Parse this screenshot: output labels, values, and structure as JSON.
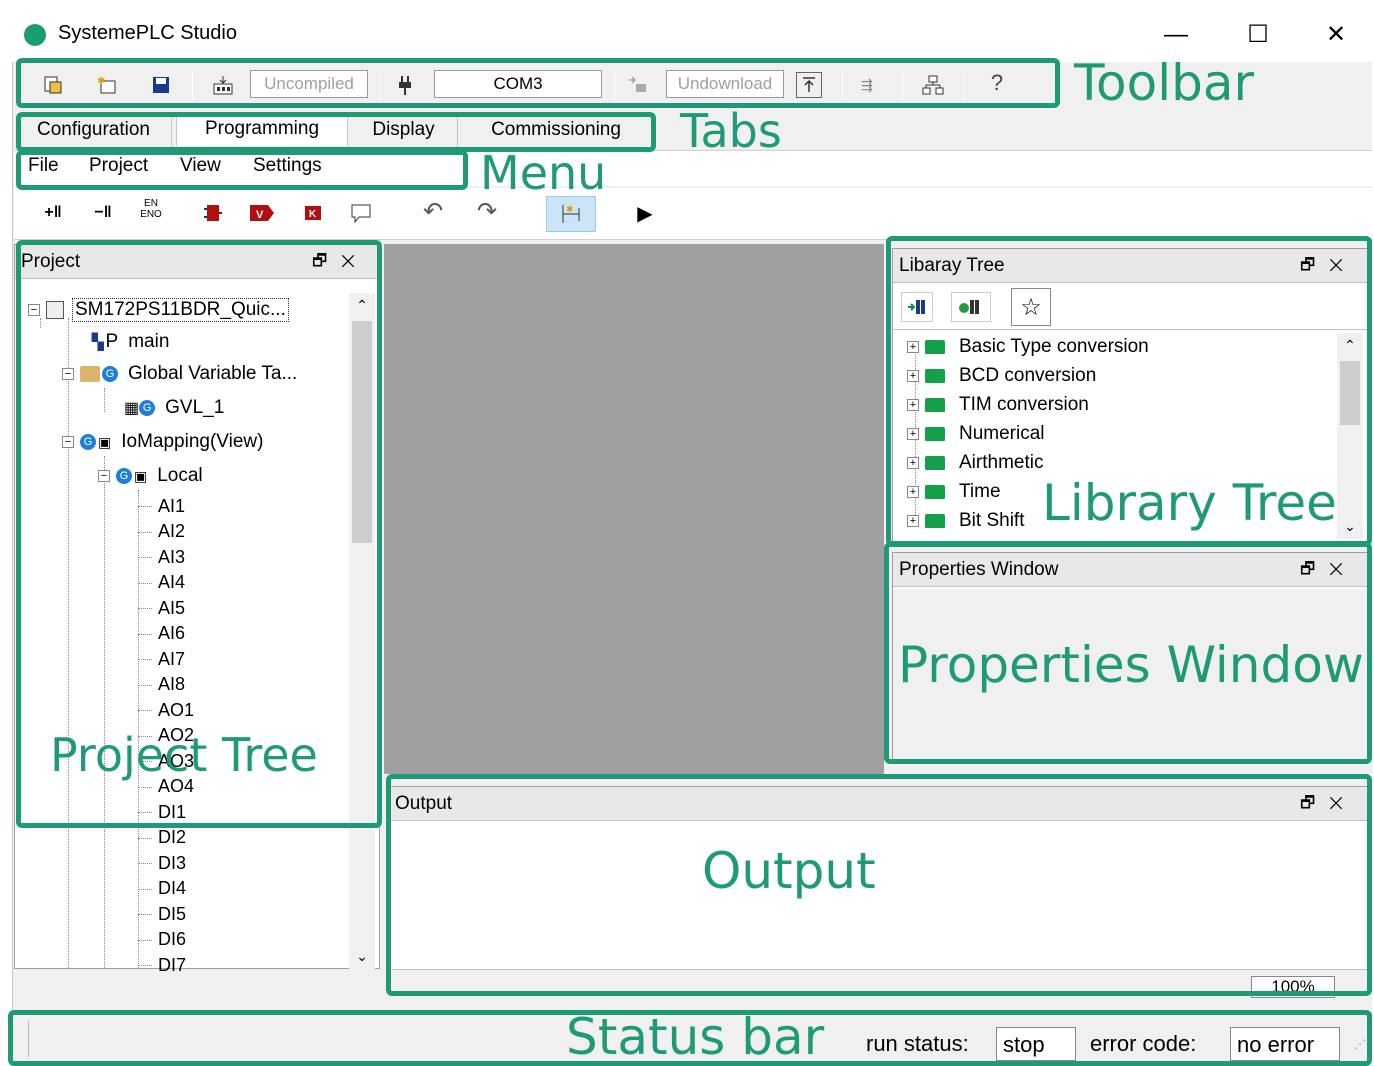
{
  "app": {
    "title": "SystemePLC Studio",
    "window_controls": {
      "minimize": "—",
      "maximize": "☐",
      "close": "✕"
    }
  },
  "toolbar": {
    "compile_status": "Uncompiled",
    "port": "COM3",
    "download_status": "Undownload"
  },
  "tabs": [
    {
      "label": "Configuration"
    },
    {
      "label": "Programming",
      "active": true
    },
    {
      "label": "Display"
    },
    {
      "label": "Commissioning"
    }
  ],
  "menu": [
    "File",
    "Project",
    "View",
    "Settings"
  ],
  "project_panel": {
    "title": "Project",
    "float_icon": "🗗",
    "close_icon": "✕",
    "tree": {
      "root": "SM172PS11BDR_Quic...",
      "main": "main",
      "global_vars": "Global Variable Ta...",
      "gvl": "GVL_1",
      "iomapping": "IoMapping(View)",
      "local": "Local",
      "io_points": [
        "AI1",
        "AI2",
        "AI3",
        "AI4",
        "AI5",
        "AI6",
        "AI7",
        "AI8",
        "AO1",
        "AO2",
        "AO3",
        "AO4",
        "DI1",
        "DI2",
        "DI3",
        "DI4",
        "DI5",
        "DI6",
        "DI7"
      ]
    }
  },
  "library_panel": {
    "title": "Libaray Tree",
    "float_icon": "🗗",
    "close_icon": "✕",
    "items": [
      "Basic Type conversion",
      "BCD conversion",
      "TIM conversion",
      "Numerical",
      "Airthmetic",
      "Time",
      "Bit Shift"
    ]
  },
  "properties_panel": {
    "title": "Properties Window",
    "float_icon": "🗗",
    "close_icon": "✕"
  },
  "output_panel": {
    "title": "Output",
    "float_icon": "🗗",
    "close_icon": "✕",
    "zoom": "100%"
  },
  "statusbar": {
    "run_status_label": "run status:",
    "run_status": "stop",
    "error_code_label": "error code:",
    "error_code": "no error"
  },
  "annotations": {
    "toolbar": "Toolbar",
    "tabs": "Tabs",
    "menu": "Menu",
    "project_tree": "Project Tree",
    "library_tree": "Library Tree",
    "properties_window": "Properties Window",
    "output": "Output",
    "status_bar": "Status bar"
  },
  "colors": {
    "annotation": "#1f9a77",
    "brand": "#1a9e6e"
  }
}
